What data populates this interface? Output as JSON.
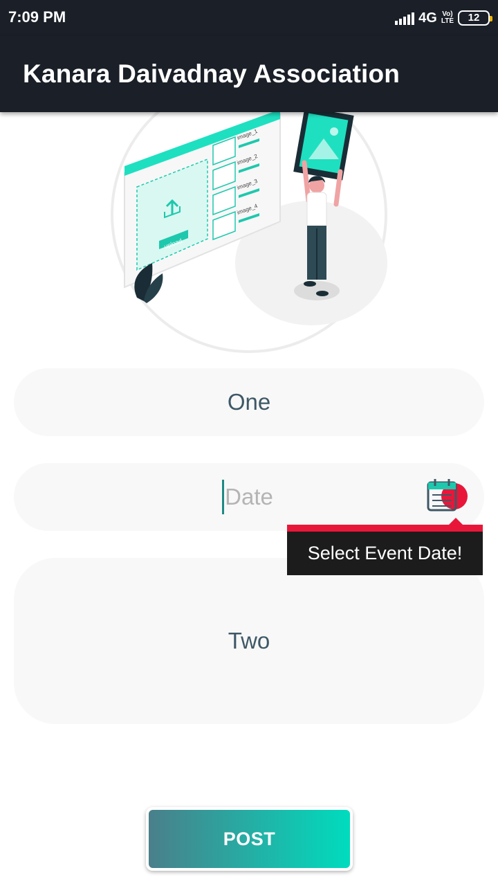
{
  "status_bar": {
    "time": "7:09 PM",
    "network": "4G",
    "volte_top": "Vo)",
    "volte_bottom": "LTE",
    "battery": "12",
    "icons": [
      "signal-icon",
      "volte-icon",
      "battery-icon"
    ]
  },
  "app_bar": {
    "title": "Kanara Daivadnay Association"
  },
  "illustration": {
    "icon": "upload-illustration",
    "upload_label": "upload",
    "image_items": [
      "image_1",
      "image_2",
      "image_3",
      "image_4"
    ],
    "accent": "#00dcbe"
  },
  "form": {
    "field_one": "One",
    "date_placeholder": "Date",
    "field_two": "Two",
    "calendar_icon": "calendar-icon",
    "error_tooltip": "Select Event Date!"
  },
  "actions": {
    "post_label": "POST"
  },
  "colors": {
    "app_bar": "#1a1f28",
    "field_bg": "#f8f8f8",
    "field_text": "#3e5866",
    "error": "#e8173a",
    "button_start": "#4a7f8a",
    "button_end": "#00dcbe"
  }
}
